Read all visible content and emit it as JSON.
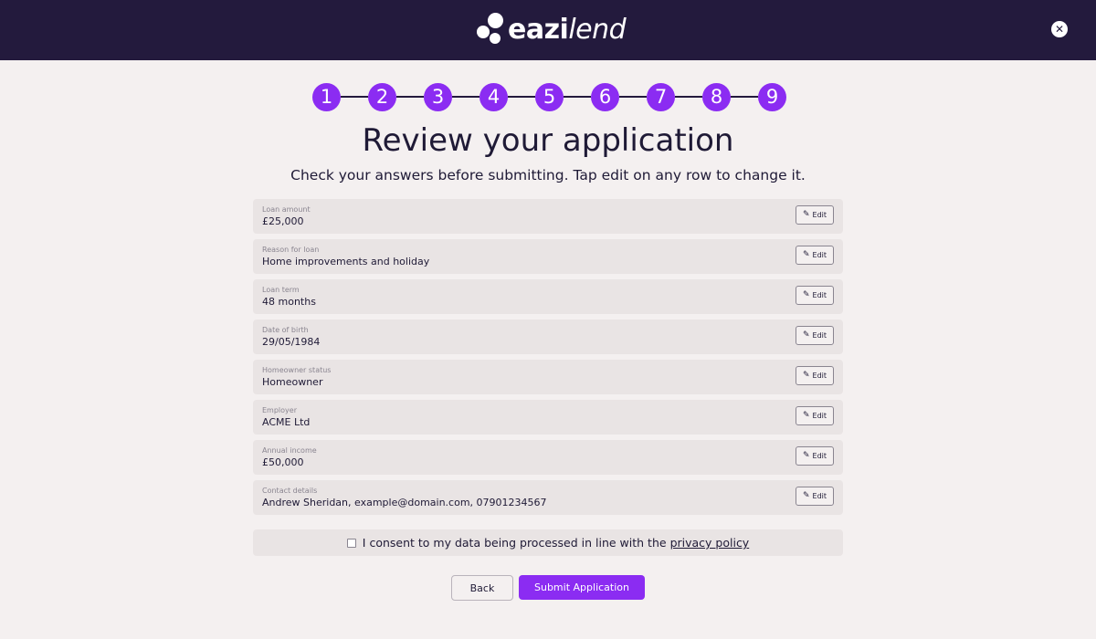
{
  "header": {
    "logo_text_bold": "eazi",
    "logo_text_italic": "lend",
    "close_glyph": "✕"
  },
  "stepper": {
    "steps": [
      "1",
      "2",
      "3",
      "4",
      "5",
      "6",
      "7",
      "8",
      "9"
    ]
  },
  "page": {
    "title": "Review your application",
    "subtitle": "Check your answers before submitting. Tap edit on any row to change it."
  },
  "review": {
    "edit_label": "Edit",
    "rows": [
      {
        "label": "Loan amount",
        "value": "£25,000"
      },
      {
        "label": "Reason for loan",
        "value": "Home improvements and holiday"
      },
      {
        "label": "Loan term",
        "value": "48 months"
      },
      {
        "label": "Date of birth",
        "value": "29/05/1984"
      },
      {
        "label": "Homeowner status",
        "value": "Homeowner"
      },
      {
        "label": "Employer",
        "value": "ACME Ltd"
      },
      {
        "label": "Annual income",
        "value": "£50,000"
      },
      {
        "label": "Contact details",
        "value": "Andrew Sheridan, example@domain.com, 07901234567"
      }
    ]
  },
  "consent": {
    "text": "I consent to my data being processed in line with the",
    "link_text": "privacy policy",
    "checked": false
  },
  "actions": {
    "back_label": "Back",
    "submit_label": "Submit Application"
  },
  "colors": {
    "header_bg": "#231a3d",
    "accent": "#8b2cf2",
    "page_bg": "#f4f0f0",
    "row_bg": "#e9e4e4"
  },
  "icons": {
    "edit": "pencil-icon",
    "close": "close-icon",
    "logo": "logo-bubbles-icon"
  }
}
